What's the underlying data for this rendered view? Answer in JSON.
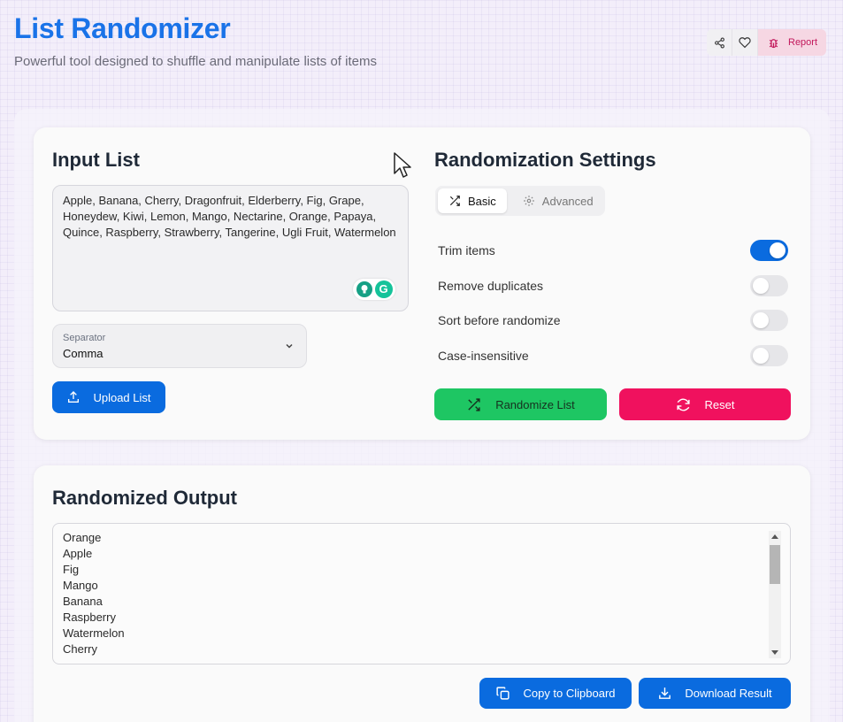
{
  "header": {
    "title": "List Randomizer",
    "subtitle": "Powerful tool designed to shuffle and manipulate lists of items",
    "report_label": "Report"
  },
  "input_section": {
    "title": "Input List",
    "text": "Apple, Banana, Cherry, Dragonfruit, Elderberry, Fig, Grape, Honeydew, Kiwi, Lemon, Mango, Nectarine, Orange, Papaya, Quince, Raspberry, Strawberry, Tangerine, Ugli Fruit, Watermelon",
    "separator_label": "Separator",
    "separator_value": "Comma",
    "upload_label": "Upload List"
  },
  "settings": {
    "title": "Randomization Settings",
    "tabs": [
      {
        "label": "Basic",
        "active": true
      },
      {
        "label": "Advanced",
        "active": false
      }
    ],
    "options": [
      {
        "label": "Trim items",
        "on": true
      },
      {
        "label": "Remove duplicates",
        "on": false
      },
      {
        "label": "Sort before randomize",
        "on": false
      },
      {
        "label": "Case-insensitive",
        "on": false
      }
    ],
    "randomize_label": "Randomize List",
    "reset_label": "Reset"
  },
  "output": {
    "title": "Randomized Output",
    "items": [
      "Orange",
      "Apple",
      "Fig",
      "Mango",
      "Banana",
      "Raspberry",
      "Watermelon",
      "Cherry"
    ],
    "copy_label": "Copy to Clipboard",
    "download_label": "Download Result"
  },
  "colors": {
    "accent": "#0a6bdf",
    "success": "#1ec663",
    "danger": "#f0115e",
    "report": "#c2185b"
  }
}
